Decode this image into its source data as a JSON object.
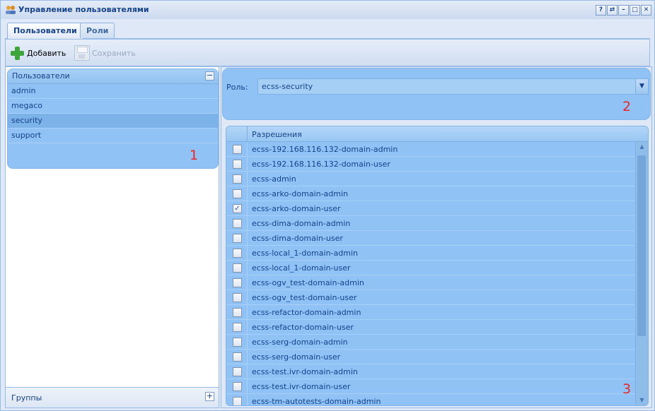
{
  "window": {
    "title": "Управление пользователями",
    "buttons": [
      "?",
      "⇄",
      "–",
      "□",
      "✕"
    ]
  },
  "tabs": [
    {
      "label": "Пользователи",
      "active": true
    },
    {
      "label": "Роли",
      "active": false
    }
  ],
  "toolbar": {
    "add_label": "Добавить",
    "save_label": "Сохранить"
  },
  "users": {
    "header": "Пользователи",
    "collapse_symbol": "−",
    "items": [
      "admin",
      "megaco",
      "security",
      "support"
    ],
    "selected": "security",
    "annotation": "1"
  },
  "groups": {
    "label": "Группы",
    "expand_symbol": "+"
  },
  "role": {
    "label": "Роль:",
    "value": "ecss-security",
    "annotation": "2"
  },
  "permissions": {
    "header": "Разрешения",
    "annotation": "3",
    "items": [
      {
        "name": "ecss-192.168.116.132-domain-admin",
        "checked": false
      },
      {
        "name": "ecss-192.168.116.132-domain-user",
        "checked": false
      },
      {
        "name": "ecss-admin",
        "checked": false
      },
      {
        "name": "ecss-arko-domain-admin",
        "checked": false
      },
      {
        "name": "ecss-arko-domain-user",
        "checked": true
      },
      {
        "name": "ecss-dima-domain-admin",
        "checked": false
      },
      {
        "name": "ecss-dima-domain-user",
        "checked": false
      },
      {
        "name": "ecss-local_1-domain-admin",
        "checked": false
      },
      {
        "name": "ecss-local_1-domain-user",
        "checked": false
      },
      {
        "name": "ecss-ogv_test-domain-admin",
        "checked": false
      },
      {
        "name": "ecss-ogv_test-domain-user",
        "checked": false
      },
      {
        "name": "ecss-refactor-domain-admin",
        "checked": false
      },
      {
        "name": "ecss-refactor-domain-user",
        "checked": false
      },
      {
        "name": "ecss-serg-domain-admin",
        "checked": false
      },
      {
        "name": "ecss-serg-domain-user",
        "checked": false
      },
      {
        "name": "ecss-test.ivr-domain-admin",
        "checked": false
      },
      {
        "name": "ecss-test.ivr-domain-user",
        "checked": false
      },
      {
        "name": "ecss-tm-autotests-domain-admin",
        "checked": false
      }
    ]
  },
  "colors": {
    "panel_blue": "#90c2f5",
    "header_text": "#15428b",
    "annotation_red": "#e8262a",
    "add_green": "#3fa53a"
  }
}
